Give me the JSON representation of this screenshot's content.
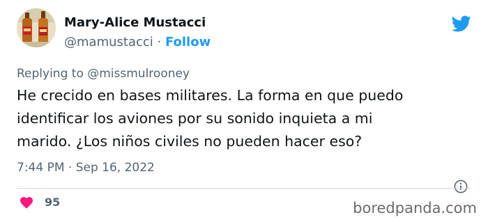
{
  "author": {
    "display_name": "Mary-Alice Mustacci",
    "handle": "@mamustacci",
    "separator": " · ",
    "follow_label": "Follow",
    "avatar_icon": "avatar-bottles-photo"
  },
  "platform_icon": "twitter-bird-icon",
  "reply": {
    "prefix": "Replying to ",
    "mention": "@missmulrooney"
  },
  "tweet": {
    "lines": [
      "He crecido en bases militares. La forma en que puedo",
      "identificar los aviones por su sonido inquieta a mi",
      "marido. ¿Los niños civiles no pueden hacer eso?"
    ],
    "timestamp": "7:44 PM · Sep 16, 2022"
  },
  "info_icon": "info-icon",
  "engagement": {
    "like_icon": "heart-icon",
    "likes": "95"
  },
  "watermark": "boredpanda.com",
  "colors": {
    "accent": "#1d9bf0",
    "heart": "#f91880",
    "muted_text": "#536471",
    "primary_text": "#0f1419",
    "divider": "#cfd9de"
  }
}
